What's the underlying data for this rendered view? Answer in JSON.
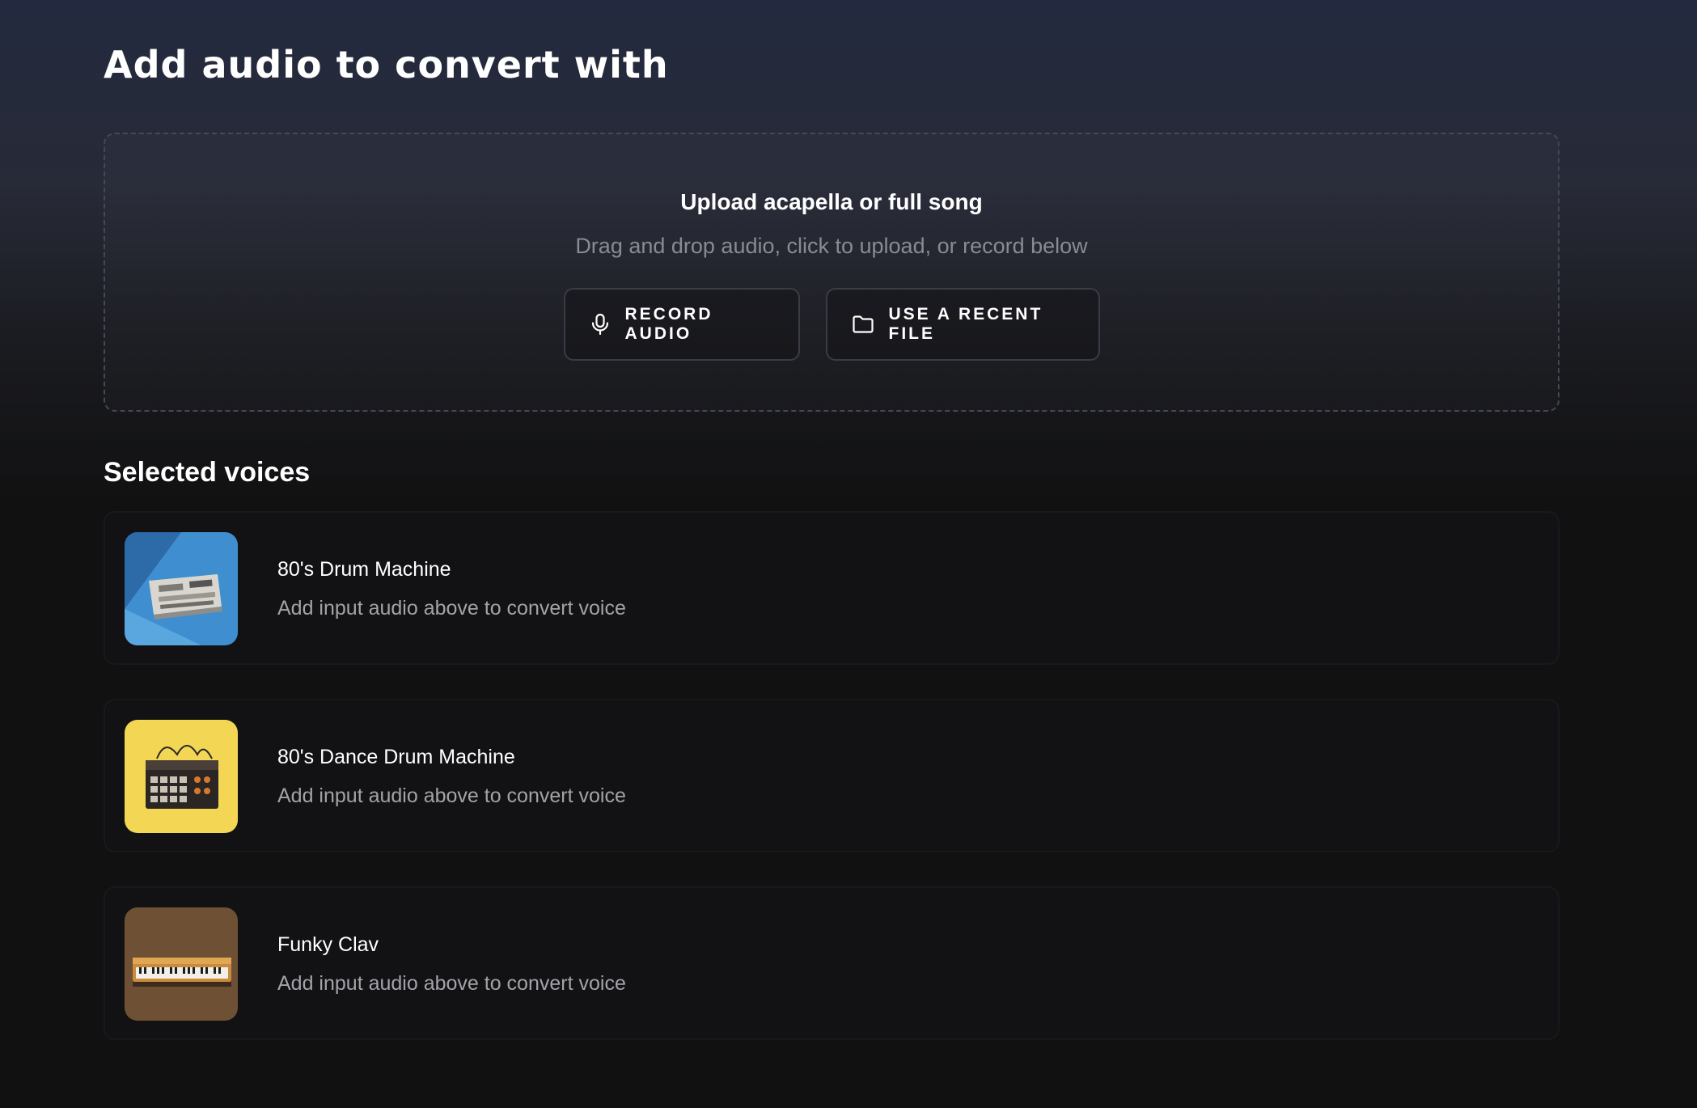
{
  "page": {
    "title": "Add audio to convert with"
  },
  "dropzone": {
    "heading": "Upload acapella or full song",
    "subtext": "Drag and drop audio, click to upload, or record below",
    "buttons": {
      "record": {
        "label": "RECORD AUDIO",
        "icon": "microphone-icon"
      },
      "recent": {
        "label": "USE A RECENT FILE",
        "icon": "folder-icon"
      }
    }
  },
  "voices": {
    "title": "Selected voices",
    "items": [
      {
        "name": "80's Drum Machine",
        "status": "Add input audio above to convert voice",
        "thumb_color": "#3f8fd0"
      },
      {
        "name": "80's Dance Drum Machine",
        "status": "Add input audio above to convert voice",
        "thumb_color": "#f2d654"
      },
      {
        "name": "Funky Clav",
        "status": "Add input audio above to convert voice",
        "thumb_color": "#6e5034"
      }
    ]
  }
}
